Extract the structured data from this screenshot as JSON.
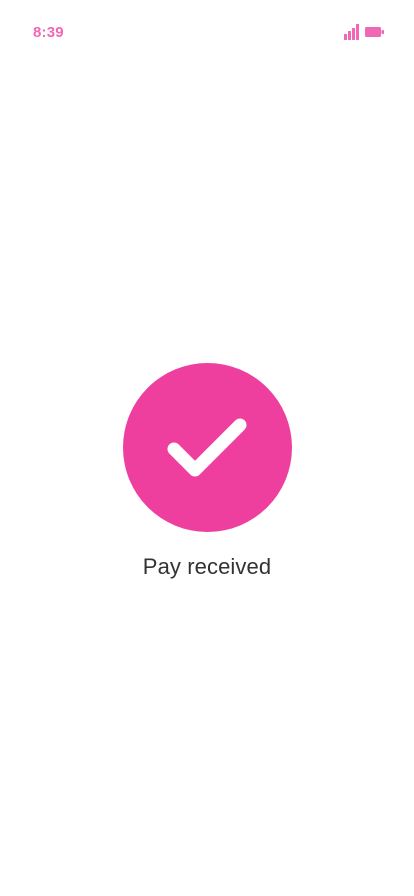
{
  "colors": {
    "accent": "#EE3F9E",
    "status": "#F067B3",
    "text": "#333333",
    "background": "#FFFFFF"
  },
  "status_bar": {
    "time": "8:39",
    "icons": [
      "signal-icon",
      "battery-icon"
    ]
  },
  "success": {
    "icon": "checkmark-icon",
    "message": "Pay received"
  }
}
